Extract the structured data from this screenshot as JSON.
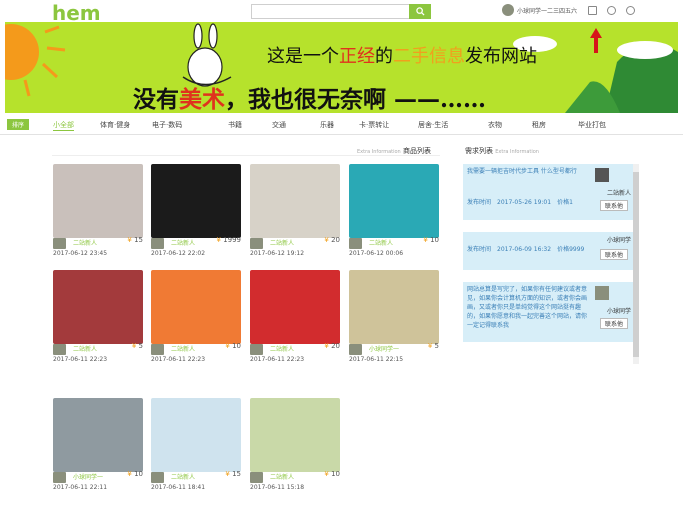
{
  "header": {
    "logo": "hem",
    "user_name": "小球同学一二三四五六"
  },
  "banner": {
    "line1_pre": "这是一个",
    "line1_red": "正经",
    "line1_mid": "的",
    "line1_org": "二手信息",
    "line1_post": "发布网站",
    "line2_pre": "没有",
    "line2_red": "美术",
    "line2_post": "，我也很无奈啊 ——……"
  },
  "nav": {
    "badge": "排序",
    "items": [
      "小全部",
      "体育·健身",
      "电子·数码",
      "书籍",
      "交通",
      "乐器",
      "卡·票转让",
      "居舍·生活",
      "衣物",
      "租房",
      "毕业打包"
    ]
  },
  "products": {
    "title": "商品列表",
    "subtitle": "Extra Information",
    "items": [
      {
        "seller": "二站新人",
        "price": "15",
        "date": "2017-06-12 23:45",
        "color": "#c9c0bb"
      },
      {
        "seller": "二站新人",
        "price": "1999",
        "date": "2017-06-12 22:02",
        "color": "#1b1b1b"
      },
      {
        "seller": "二站新人",
        "price": "20",
        "date": "2017-06-12 19:12",
        "color": "#d7d2c8"
      },
      {
        "seller": "二站新人",
        "price": "10",
        "date": "2017-06-12 00:06",
        "color": "#2aa9b5"
      },
      {
        "seller": "二站新人",
        "price": "5",
        "date": "2017-06-11 22:23",
        "color": "#a33a3c"
      },
      {
        "seller": "二站新人",
        "price": "10",
        "date": "2017-06-11 22:23",
        "color": "#f07a34"
      },
      {
        "seller": "二站新人",
        "price": "20",
        "date": "2017-06-11 22:23",
        "color": "#d22c2e"
      },
      {
        "seller": "小球同学一",
        "price": "5",
        "date": "2017-06-11 22:15",
        "color": "#cfc39a"
      },
      {
        "seller": "小球同学一",
        "price": "10",
        "date": "2017-06-11 22:11",
        "color": "#8f9aa0"
      },
      {
        "seller": "二站新人",
        "price": "15",
        "date": "2017-06-11 18:41",
        "color": "#cfe3ee"
      },
      {
        "seller": "二站新人",
        "price": "10",
        "date": "2017-06-11 15:18",
        "color": "#c9d9a8"
      }
    ]
  },
  "needs": {
    "title": "需求列表",
    "subtitle": "Extra Information",
    "items": [
      {
        "text": "我需要一辆拒吉时代步工具 什么型号都行",
        "time": "发布时间　2017-05-26 19:01　价格1",
        "user": "二站新人",
        "contact": "联系他"
      },
      {
        "text": "",
        "time": "发布时间　2017-06-09 16:32　价格9999",
        "user": "小球同学",
        "contact": "联系他"
      },
      {
        "text": "网站总算是写完了，如果你有任何建议或者意见，如果你会计算机方面的知识，或者你会画画，又或者你只是单纯觉得这个网站挺有趣的，如果你愿意和我一起完善这个网站，请你一定记得联系我",
        "time": "",
        "user": "小球同学",
        "contact": "联系他"
      }
    ]
  }
}
